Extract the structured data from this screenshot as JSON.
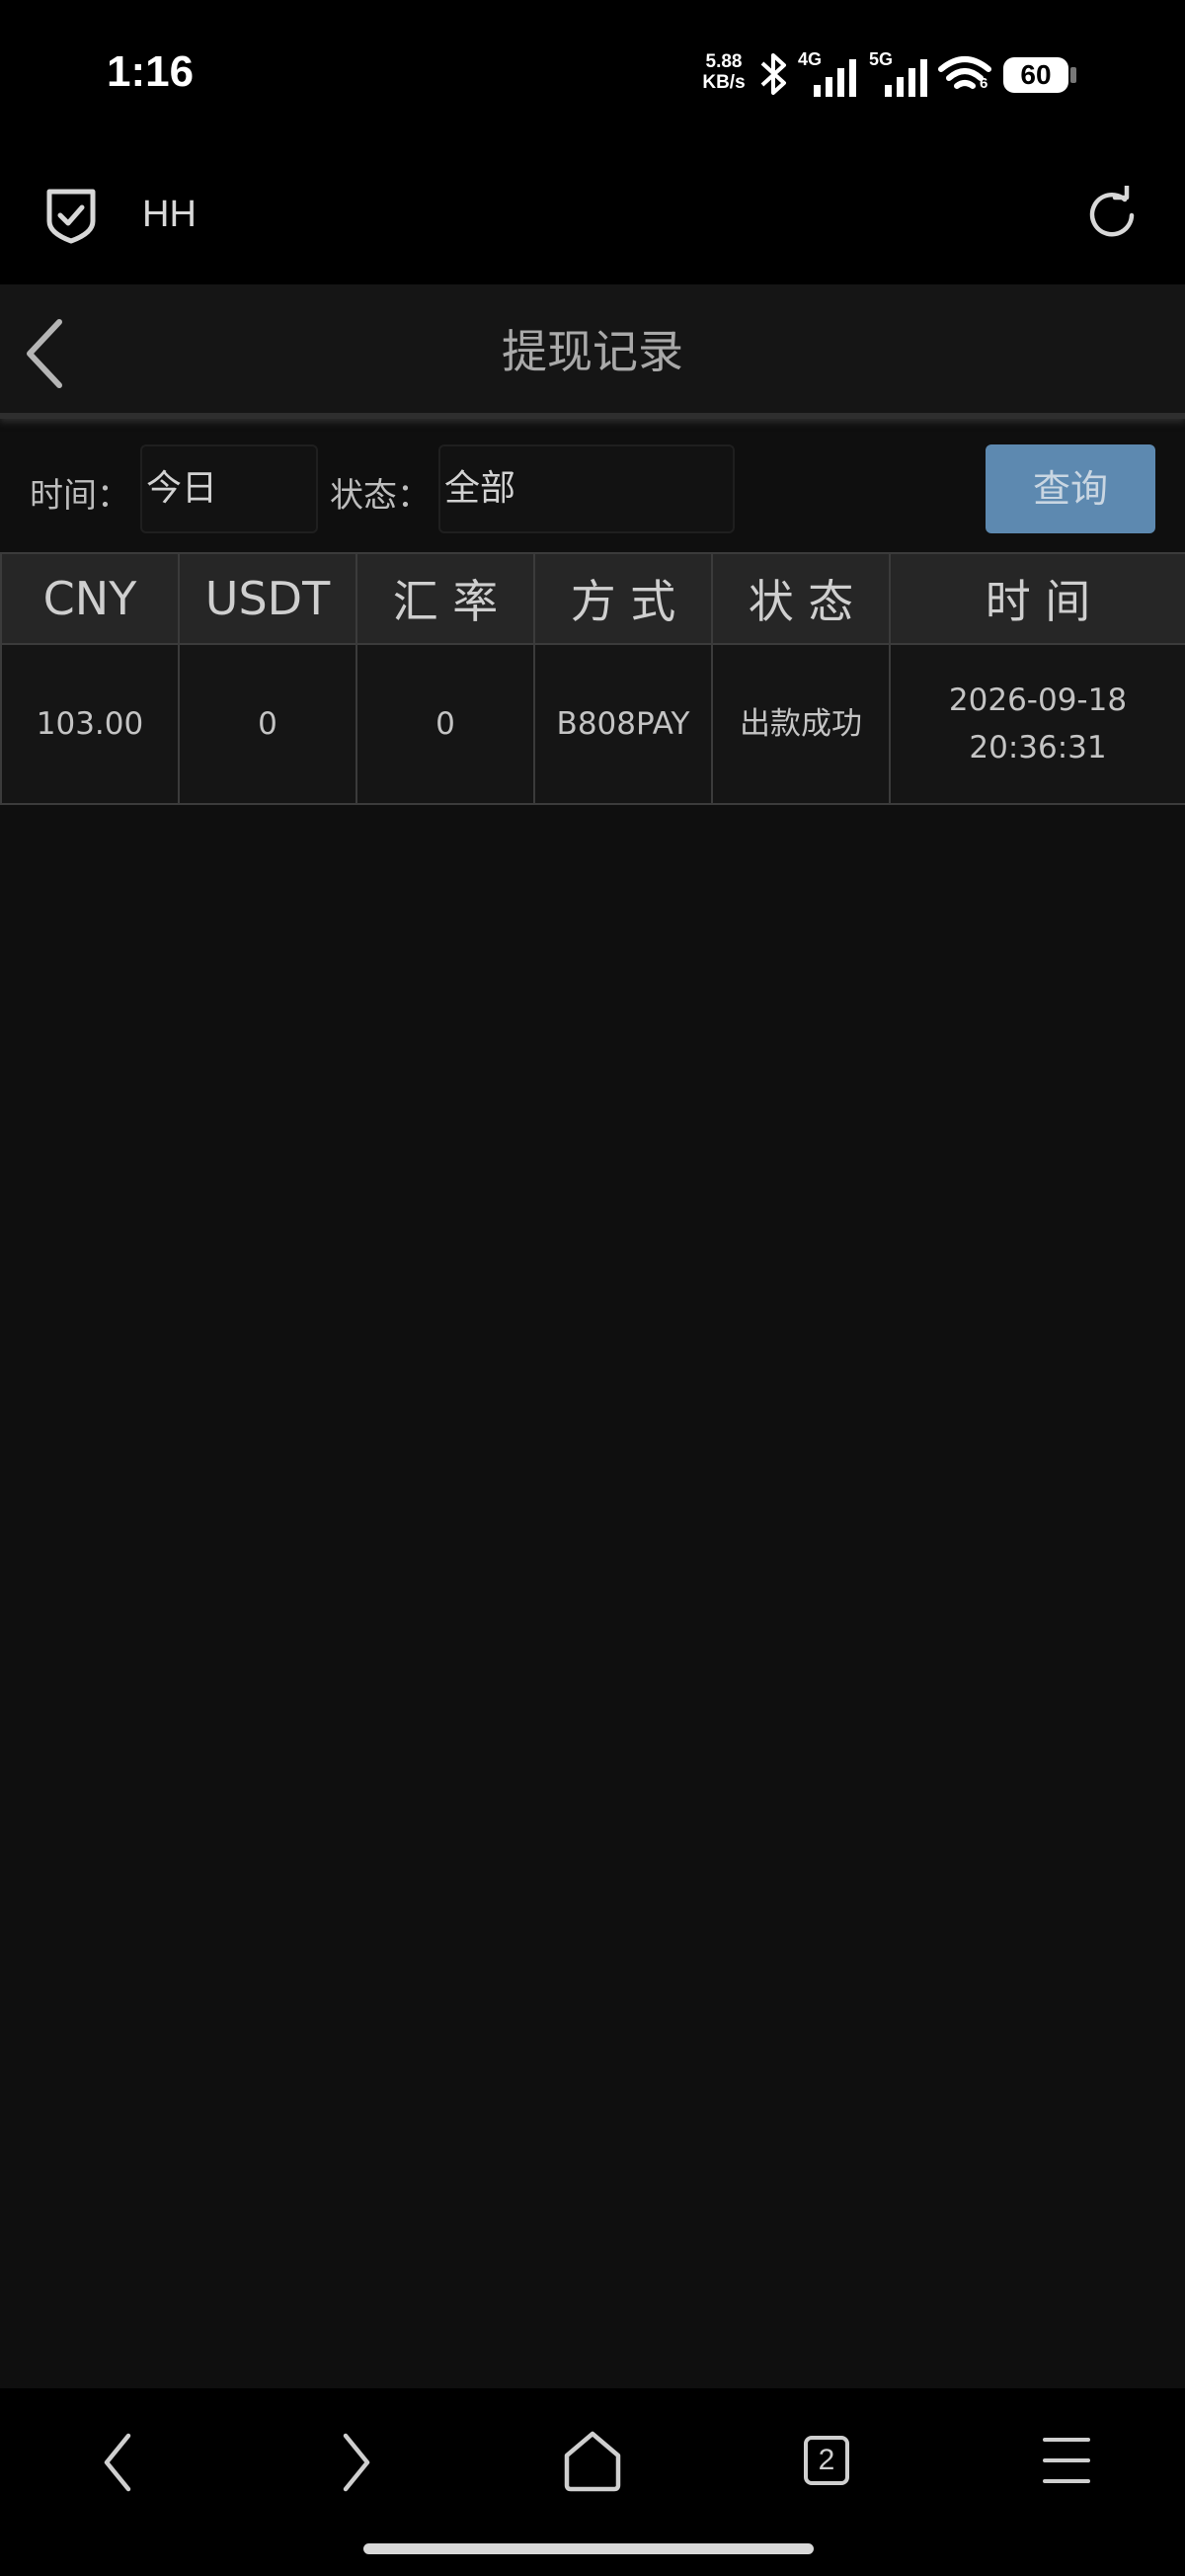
{
  "status_bar": {
    "time": "1:16",
    "net_speed_value": "5.88",
    "net_speed_unit": "KB/s",
    "network_4g": "4G",
    "network_5g": "5G",
    "wifi_sub": "6",
    "battery": "60"
  },
  "browser": {
    "site_title": "HH"
  },
  "header": {
    "title": "提现记录"
  },
  "filters": {
    "time_label": "时间：",
    "time_value": "今日",
    "status_label": "状态：",
    "status_value": "全部",
    "query_label": "查询"
  },
  "table": {
    "headers": [
      "CNY",
      "USDT",
      "汇 率",
      "方 式",
      "状 态",
      "时 间"
    ],
    "rows": [
      {
        "cny": "103.00",
        "usdt": "0",
        "rate": "0",
        "method": "B808PAY",
        "status": "出款成功",
        "date": "2026-09-18",
        "clock": "20:36:31"
      }
    ]
  },
  "bottom_nav": {
    "tab_count": "2"
  }
}
